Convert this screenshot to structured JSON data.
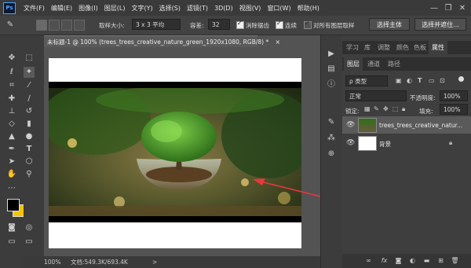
{
  "app": {
    "logo": "Ps"
  },
  "menu": [
    "文件(F)",
    "编辑(E)",
    "图像(I)",
    "图层(L)",
    "文字(Y)",
    "选择(S)",
    "滤镜(T)",
    "3D(D)",
    "视图(V)",
    "窗口(W)",
    "帮助(H)"
  ],
  "window_controls": [
    "—",
    "❐",
    "✕"
  ],
  "options": {
    "sample_size_label": "取样大小:",
    "sample_size_value": "3 x 3 平均",
    "tolerance_label": "容差:",
    "tolerance_value": "32",
    "antialias_label": "消除锯齿",
    "contiguous_label": "连续",
    "sample_all_label": "对所有图层取样",
    "select_subject": "选择主体",
    "select_mask": "选择并遮住..."
  },
  "document": {
    "tab_title": "未标题-1 @ 100% (trees_trees_creative_nature_green_1920x1080, RGB/8) *",
    "close": "×"
  },
  "status": {
    "zoom": "100%",
    "doc_info": "文档:549.3K/693.4K",
    "arrow": ">"
  },
  "panel_tabs_top": [
    "学习",
    "库",
    "调整",
    "颜色",
    "色板",
    "属性"
  ],
  "panel_tabs_layers": [
    "图层",
    "通道",
    "路径"
  ],
  "layers_panel": {
    "filter_kind": "ρ 类型",
    "blend_mode": "正常",
    "opacity_label": "不透明度:",
    "opacity_value": "100%",
    "lock_label": "锁定:",
    "fill_label": "填充:",
    "fill_value": "100%",
    "layers": [
      {
        "name": "trees_trees_creative_natur...",
        "visible": true,
        "selected": true
      },
      {
        "name": "背景",
        "visible": true,
        "selected": false,
        "locked": true
      }
    ]
  },
  "colors": {
    "foreground": "#000000",
    "background": "#f5c400",
    "arrow": "#e8383d",
    "accent": "#4fa3ff"
  },
  "icons": {
    "tools": [
      "move-icon",
      "marquee-icon",
      "lasso-icon",
      "magic-wand-icon",
      "crop-icon",
      "eyedropper-icon",
      "healing-icon",
      "brush-icon",
      "stamp-icon",
      "history-brush-icon",
      "eraser-icon",
      "gradient-icon",
      "blur-icon",
      "dodge-icon",
      "pen-icon",
      "type-icon",
      "path-select-icon",
      "shape-icon",
      "hand-icon",
      "zoom-icon",
      "more-tools-icon"
    ]
  }
}
